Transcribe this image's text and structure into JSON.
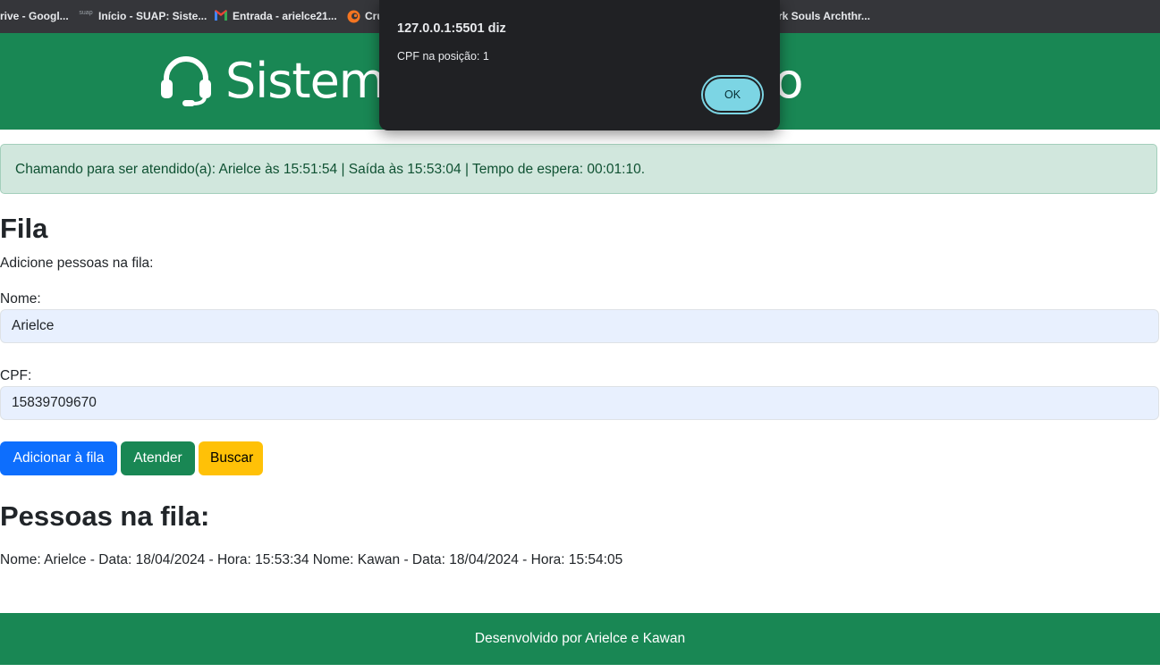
{
  "bookmarks": [
    {
      "label": "rive - Googl...",
      "icon": "drive-icon"
    },
    {
      "label": "Início - SUAP: Siste...",
      "icon": "suap-icon"
    },
    {
      "label": "Entrada - arielce21...",
      "icon": "gmail-icon"
    },
    {
      "label": "Cru",
      "icon": "crunchyroll-icon"
    },
    {
      "label": "rk Souls Archthr...",
      "icon": "bookmark-icon"
    }
  ],
  "suap_icon_text": "suap",
  "header": {
    "title": "Sistema de Atendimento",
    "icon": "headset-icon"
  },
  "alert": {
    "message": "Chamando para ser atendido(a): Arielce às 15:51:54 | Saída às 15:53:04 | Tempo de espera: 00:01:10."
  },
  "form": {
    "heading": "Fila",
    "subtitle": "Adicione pessoas na fila:",
    "name_label": "Nome:",
    "name_value": "Arielce",
    "cpf_label": "CPF:",
    "cpf_value": "15839709670",
    "buttons": {
      "add": "Adicionar à fila",
      "attend": "Atender",
      "search": "Buscar"
    }
  },
  "queue": {
    "heading": "Pessoas na fila:",
    "text": "Nome: Arielce - Data: 18/04/2024 - Hora: 15:53:34 Nome: Kawan - Data: 18/04/2024 - Hora: 15:54:05"
  },
  "footer": {
    "text": "Desenvolvido por Arielce e Kawan"
  },
  "dialog": {
    "title": "127.0.0.1:5501 diz",
    "message": "CPF na posição: 1",
    "ok": "OK"
  },
  "colors": {
    "brand_green": "#198754",
    "primary": "#0d6efd",
    "warning": "#ffc107",
    "alert_bg": "#d1e7dd"
  }
}
